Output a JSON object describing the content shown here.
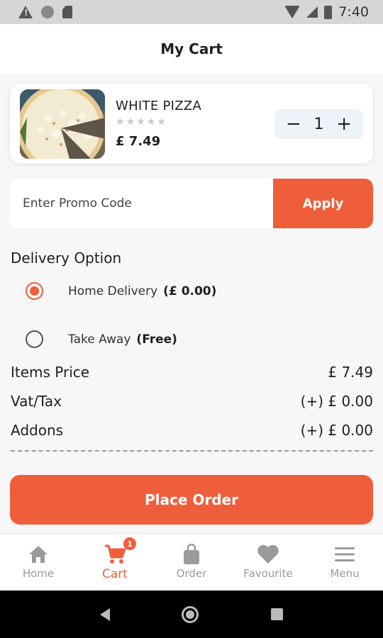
{
  "status_bar": {
    "time": "7:40"
  },
  "header": {
    "title": "My Cart"
  },
  "cart_item": {
    "name": "WHITE PIZZA",
    "rating_stars": 0,
    "rating_max": 5,
    "price": "£ 7.49",
    "quantity": "1",
    "decrement": "−",
    "increment": "+"
  },
  "promo": {
    "placeholder": "Enter Promo Code",
    "apply_label": "Apply"
  },
  "delivery": {
    "title": "Delivery Option",
    "options": [
      {
        "label": "Home Delivery",
        "extra": "(£ 0.00)",
        "selected": true
      },
      {
        "label": "Take Away",
        "extra": "(Free)",
        "selected": false
      }
    ]
  },
  "summary": [
    {
      "label": "Items Price",
      "value": "£ 7.49"
    },
    {
      "label": "Vat/Tax",
      "value": "(+) £ 0.00"
    },
    {
      "label": "Addons",
      "value": "(+) £ 0.00"
    }
  ],
  "place_order_label": "Place Order",
  "bottom_nav": {
    "items": [
      {
        "label": "Home",
        "icon": "home-icon",
        "active": false
      },
      {
        "label": "Cart",
        "icon": "cart-icon",
        "active": true,
        "badge": "1"
      },
      {
        "label": "Order",
        "icon": "shopping-bag-icon",
        "active": false
      },
      {
        "label": "Favourite",
        "icon": "heart-icon",
        "active": false
      },
      {
        "label": "Menu",
        "icon": "menu-icon",
        "active": false
      }
    ]
  },
  "colors": {
    "accent": "#ef5e3b",
    "inactive": "#9a9a9a"
  }
}
